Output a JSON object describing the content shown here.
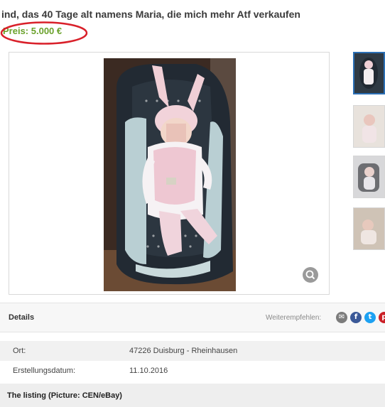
{
  "listing": {
    "title": "ind, das 40 Tage alt namens Maria, die mich mehr Atf verkaufen",
    "price": "Preis: 5.000 €"
  },
  "details": {
    "heading": "Details",
    "share_label": "Weiterempfehlen:",
    "share_icons": [
      "email-icon",
      "facebook-icon",
      "twitter-icon",
      "pinterest-icon"
    ],
    "rows": [
      {
        "label": "Ort:",
        "value": "47226 Duisburg - Rheinhausen"
      },
      {
        "label": "Erstellungsdatum:",
        "value": "11.10.2016"
      }
    ]
  },
  "caption": "The listing (Picture: CEN/eBay)",
  "colors": {
    "price": "#6aa12b",
    "annotation_circle": "#d9202a",
    "facebook": "#3b5998",
    "twitter": "#1da1f2",
    "pinterest": "#cb2027",
    "active_thumb_border": "#2b6fb5"
  }
}
